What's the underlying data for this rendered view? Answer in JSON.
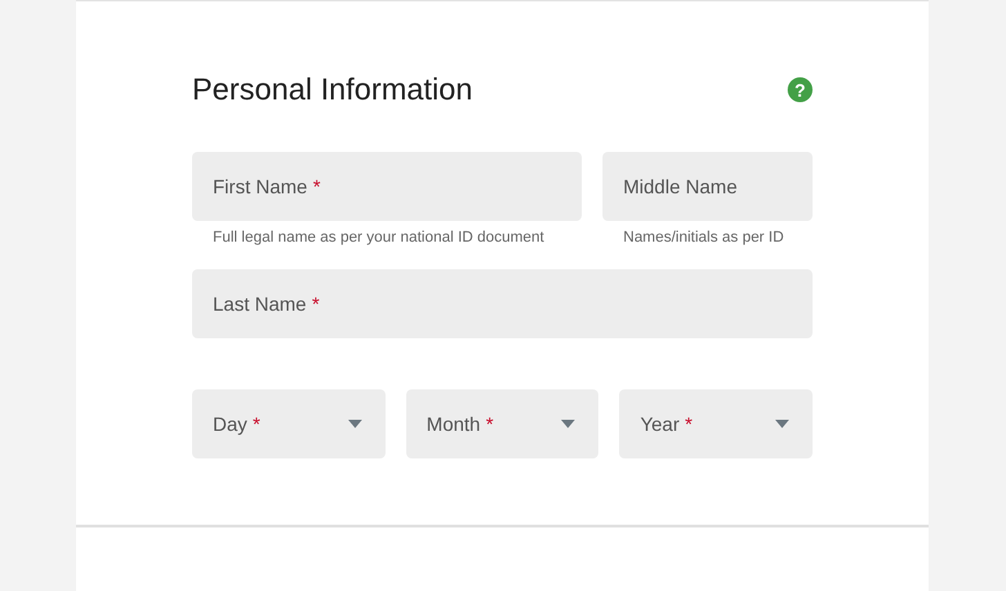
{
  "section": {
    "title": "Personal Information",
    "help_icon": "?"
  },
  "name_fields": [
    {
      "label": "First Name",
      "required_mark": "*",
      "helper": "Full legal name as per your national ID document",
      "kind": "wide"
    },
    {
      "label": "Middle Name",
      "helper": "Names/initials as per ID",
      "kind": "narrow"
    }
  ],
  "last_name_field": {
    "label": "Last Name",
    "required_mark": "*"
  },
  "date_selects": [
    {
      "label": "Day",
      "required_mark": "*"
    },
    {
      "label": "Month",
      "required_mark": "*"
    },
    {
      "label": "Year",
      "required_mark": "*"
    }
  ]
}
